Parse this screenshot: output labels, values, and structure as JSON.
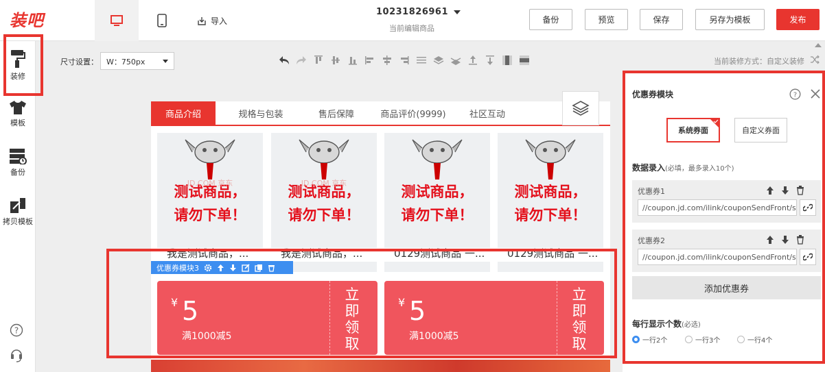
{
  "app": {
    "logo": "装吧"
  },
  "header": {
    "import_label": "导入",
    "product_id": "10231826961",
    "product_sub": "当前编辑商品",
    "buttons": {
      "backup": "备份",
      "preview": "预览",
      "save": "保存",
      "save_template": "另存为模板",
      "publish": "发布"
    }
  },
  "sidebar": {
    "items": [
      {
        "label": "装修",
        "icon": "paint-roller-icon"
      },
      {
        "label": "模板",
        "icon": "shirt-icon"
      },
      {
        "label": "备份",
        "icon": "server-backup-icon"
      },
      {
        "label": "拷贝模板",
        "icon": "copy-template-icon"
      }
    ]
  },
  "toolbar": {
    "size_label": "尺寸设置：",
    "size_value": "W：750px",
    "mode_text": "当前装修方式：自定义装修"
  },
  "canvas": {
    "tabs": [
      "商品介绍",
      "规格与包装",
      "售后保障",
      "商品评价(9999)",
      "社区互动"
    ],
    "products": [
      {
        "line1": "测试商品，",
        "line2": "请勿下单！",
        "watermark": "JD.COM 京东",
        "name": "我是测试商品，..."
      },
      {
        "line1": "测试商品，",
        "line2": "请勿下单！",
        "watermark": "JD.COM 京东",
        "name": "我是测试商品，..."
      },
      {
        "line1": "测试商品，",
        "line2": "请勿下单！",
        "watermark": "",
        "name": "0129测试商品 一..."
      },
      {
        "line1": "测试商品，",
        "line2": "请勿下单！",
        "watermark": "",
        "name": "0129测试商品 一..."
      }
    ],
    "module_label": "优惠券模块3",
    "coupons": [
      {
        "currency": "¥",
        "amount": "5",
        "condition": "满1000减5",
        "action": "立即领取"
      },
      {
        "currency": "¥",
        "amount": "5",
        "condition": "满1000减5",
        "action": "立即领取"
      }
    ]
  },
  "panel": {
    "title": "优惠券模块",
    "switch_system": "系统券面",
    "switch_custom": "自定义券面",
    "section_title": "数据录入",
    "section_hint": "(必填，最多录入10个)",
    "coupons": [
      {
        "name": "优惠券1",
        "url": "//coupon.jd.com/ilink/couponSendFront/s"
      },
      {
        "name": "优惠券2",
        "url": "//coupon.jd.com/ilink/couponSendFront/s"
      }
    ],
    "add_label": "添加优惠券",
    "rows_title": "每行显示个数",
    "rows_hint": "(必选)",
    "row_options": [
      "一行2个",
      "一行3个",
      "一行4个"
    ],
    "row_selected": "一行2个"
  },
  "colors": {
    "brand": "#e8352f",
    "coupon": "#f0555d",
    "accent": "#3d8ef0"
  }
}
